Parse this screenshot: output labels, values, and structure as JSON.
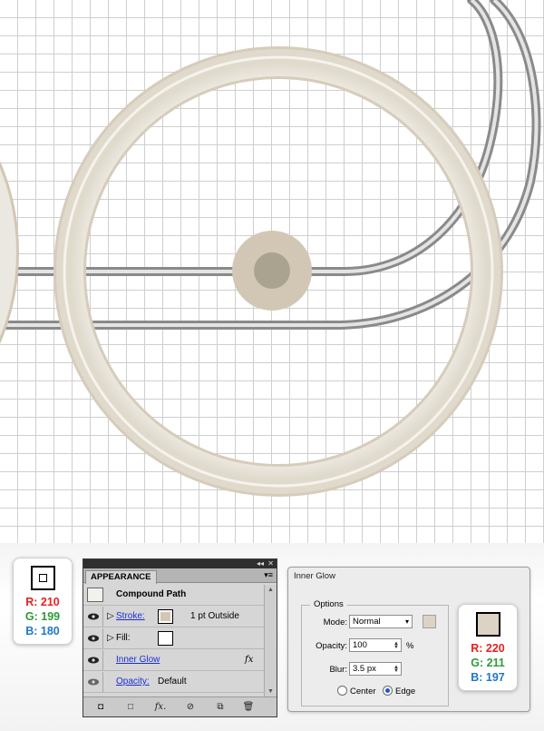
{
  "left_swatch": {
    "r": "R: 210",
    "g": "G: 199",
    "b": "B: 180",
    "color": "#d2c7b4"
  },
  "right_swatch": {
    "r": "R: 220",
    "g": "G: 211",
    "b": "B: 197",
    "color": "#dcd3c5"
  },
  "appearance_panel": {
    "tab": "APPEARANCE",
    "object": "Compound Path",
    "stroke_label": "Stroke:",
    "stroke_value": "1 pt  Outside",
    "fill_label": "Fill:",
    "inner_glow_label": "Inner Glow",
    "fx_label": "fx",
    "opacity_label": "Opacity:",
    "opacity_value": "Default",
    "stroke_color": "#d2c7b4"
  },
  "inner_glow_dialog": {
    "title": "Inner Glow",
    "options_label": "Options",
    "mode_label": "Mode:",
    "mode_value": "Normal",
    "opacity_label": "Opacity:",
    "opacity_value": "100",
    "opacity_unit": "%",
    "blur_label": "Blur:",
    "blur_value": "3.5 px",
    "center_label": "Center",
    "edge_label": "Edge",
    "selected_option": "Edge",
    "glow_color": "#dcd3c5"
  },
  "colors": {
    "ring": "#ebe8e1",
    "ring_stroke": "#d2c7b4",
    "hub_outer": "#d2c7b4",
    "hub_inner": "#a9a390",
    "rod": "#b8b8b8"
  }
}
